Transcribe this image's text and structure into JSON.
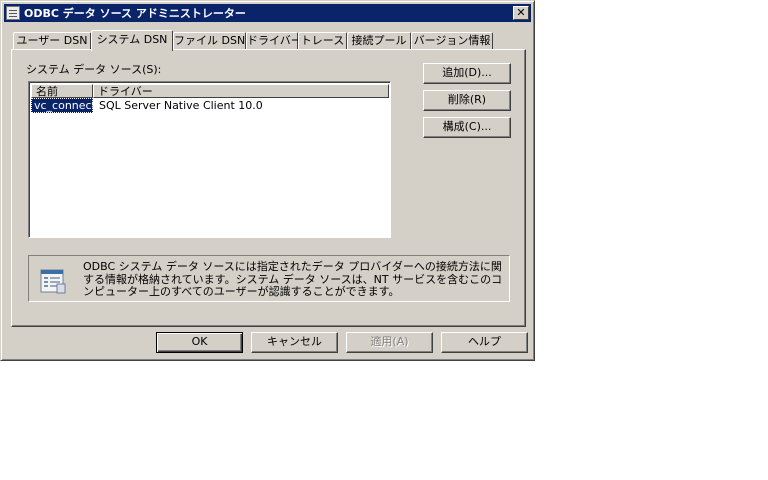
{
  "window": {
    "title": "ODBC データ ソース アドミニストレーター",
    "close_label": "✕"
  },
  "tabs": [
    {
      "label": "ユーザー DSN",
      "active": false
    },
    {
      "label": "システム DSN",
      "active": true
    },
    {
      "label": "ファイル DSN",
      "active": false
    },
    {
      "label": "ドライバー",
      "active": false
    },
    {
      "label": "トレース",
      "active": false
    },
    {
      "label": "接続プール",
      "active": false
    },
    {
      "label": "バージョン情報",
      "active": false
    }
  ],
  "system_dsn": {
    "section_label": "システム データ ソース(S):",
    "columns": [
      "名前",
      "ドライバー"
    ],
    "rows": [
      {
        "name": "vc_connect",
        "driver": "SQL Server Native Client 10.0",
        "selected": true
      }
    ],
    "buttons": {
      "add": "追加(D)...",
      "remove": "削除(R)",
      "configure": "構成(C)..."
    },
    "info_text": "ODBC システム データ ソースには指定されたデータ プロバイダーへの接続方法に関する情報が格納されています。システム データ ソースは、NT サービスを含むこのコンピューター上のすべてのユーザーが認識することができます。",
    "info_icon": "data-sources-icon"
  },
  "footer": {
    "ok": "OK",
    "cancel": "キャンセル",
    "apply": "適用(A)",
    "help": "ヘルプ"
  },
  "colors": {
    "titlebar": "#0a246a",
    "face": "#d4d0c8",
    "selection": "#0a246a"
  }
}
